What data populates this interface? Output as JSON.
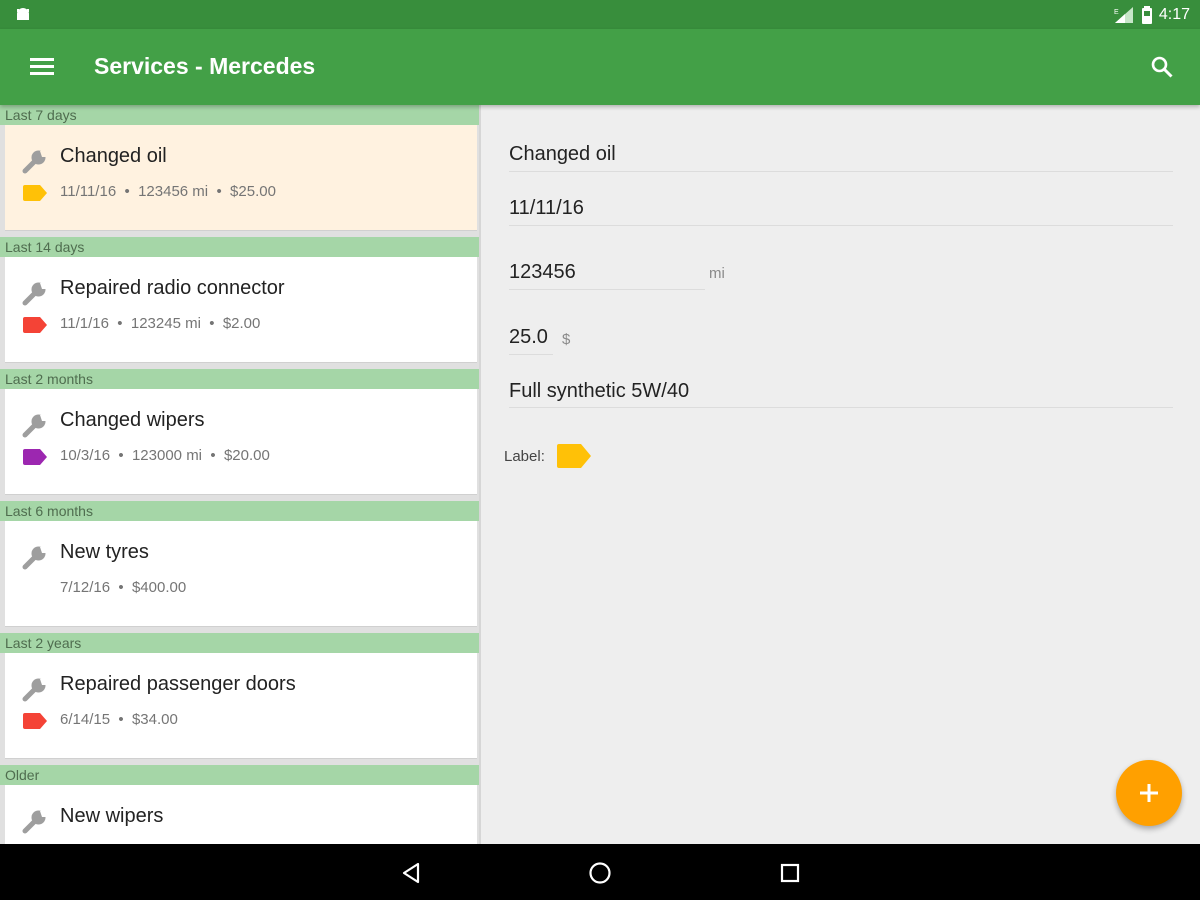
{
  "status_bar": {
    "time": "4:17"
  },
  "app_bar": {
    "title": "Services - Mercedes"
  },
  "colors": {
    "primary": "#43a047",
    "primary_dark": "#388e3c",
    "section_header": "#a5d6a7",
    "selected_card": "#fff2e0",
    "accent": "#ffa000",
    "label_yellow": "#ffc107",
    "label_red": "#f44336",
    "label_purple": "#9c27b0"
  },
  "services": [
    {
      "section": "Last 7 days",
      "title": "Changed oil",
      "meta": "11/11/16  •  123456 mi  •  $25.00",
      "label_icon": "tag-icon",
      "label_color": "#ffc107",
      "selected": true
    },
    {
      "section": "Last 14 days",
      "title": "Repaired radio connector",
      "meta": "11/1/16  •  123245 mi  •  $2.00",
      "label_icon": "tag-icon",
      "label_color": "#f44336",
      "selected": false
    },
    {
      "section": "Last 2 months",
      "title": "Changed wipers",
      "meta": "10/3/16  •  123000 mi  •  $20.00",
      "label_icon": "tag-icon",
      "label_color": "#9c27b0",
      "selected": false
    },
    {
      "section": "Last 6 months",
      "title": "New tyres",
      "meta": "7/12/16  •  $400.00",
      "label_icon": null,
      "label_color": null,
      "selected": false
    },
    {
      "section": "Last 2 years",
      "title": "Repaired passenger doors",
      "meta": "6/14/15  •  $34.00",
      "label_icon": "tag-icon",
      "label_color": "#f44336",
      "selected": false
    },
    {
      "section": "Older",
      "title": "New wipers",
      "meta": "",
      "label_icon": null,
      "label_color": null,
      "selected": false
    }
  ],
  "detail": {
    "title": "Changed oil",
    "date": "11/11/16",
    "odometer": "123456",
    "odometer_unit": "mi",
    "cost": "25.0",
    "cost_unit": "$",
    "notes": "Full synthetic 5W/40",
    "label_caption": "Label:",
    "label_color": "#ffc107"
  },
  "fab": {
    "icon": "plus-icon"
  },
  "nav": {
    "back_icon": "back-icon",
    "home_icon": "home-icon",
    "recents_icon": "recents-icon"
  }
}
